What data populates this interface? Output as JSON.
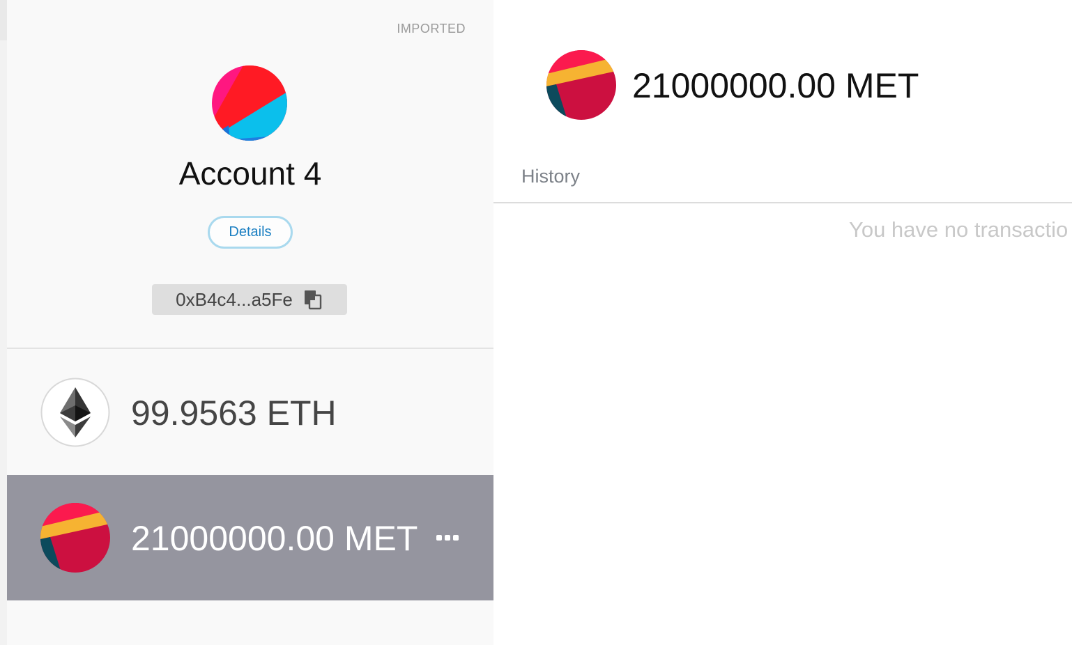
{
  "account": {
    "imported_label": "IMPORTED",
    "name": "Account 4",
    "details_label": "Details",
    "address": "0xB4c4...a5Fe"
  },
  "tokens": [
    {
      "amount": "99.9563 ETH",
      "icon": "ethereum-icon"
    },
    {
      "amount": "21000000.00 MET",
      "icon": "met-token-icon",
      "selected": true
    }
  ],
  "main": {
    "balance": "21000000.00 MET",
    "history_tab": "History",
    "empty_message": "You have no transactio"
  },
  "colors": {
    "selected_row_bg": "#95959f",
    "details_border": "#a9d9ee",
    "details_text": "#1b7fc2"
  }
}
